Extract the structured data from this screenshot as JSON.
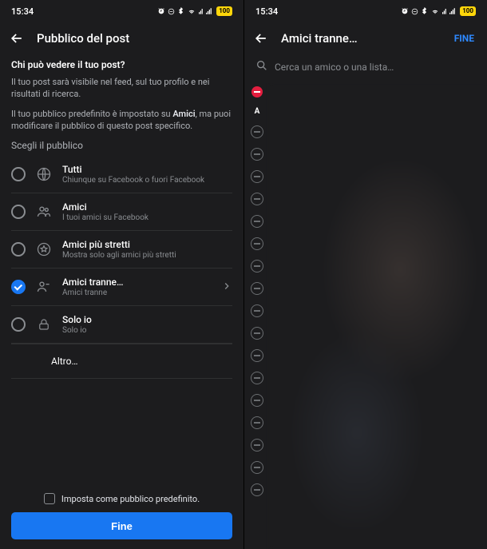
{
  "status": {
    "time": "15:34",
    "battery": "100"
  },
  "left": {
    "header_title": "Pubblico del post",
    "question": "Chi può vedere il tuo post?",
    "info1": "Il tuo post sarà visibile nel feed, sul tuo profilo e nei risultati di ricerca.",
    "info2_pre": "Il tuo pubblico predefinito è impostato su ",
    "info2_bold": "Amici",
    "info2_post": ", ma puoi modificare il pubblico di questo post specifico.",
    "choose_label": "Scegli il pubblico",
    "options": {
      "public": {
        "title": "Tutti",
        "sub": "Chiunque su Facebook o fuori Facebook"
      },
      "friends": {
        "title": "Amici",
        "sub": "I tuoi amici su Facebook"
      },
      "close": {
        "title": "Amici più stretti",
        "sub": "Mostra solo agli amici più stretti"
      },
      "except": {
        "title": "Amici tranne…",
        "sub": "Amici tranne"
      },
      "onlyme": {
        "title": "Solo io",
        "sub": "Solo io"
      }
    },
    "more_label": "Altro…",
    "default_label": "Imposta come pubblico predefinito.",
    "done_button": "Fine"
  },
  "right": {
    "header_title": "Amici tranne…",
    "action": "FINE",
    "search_placeholder": "Cerca un amico o una lista…",
    "alpha_header": "A",
    "remove_count": 17
  }
}
